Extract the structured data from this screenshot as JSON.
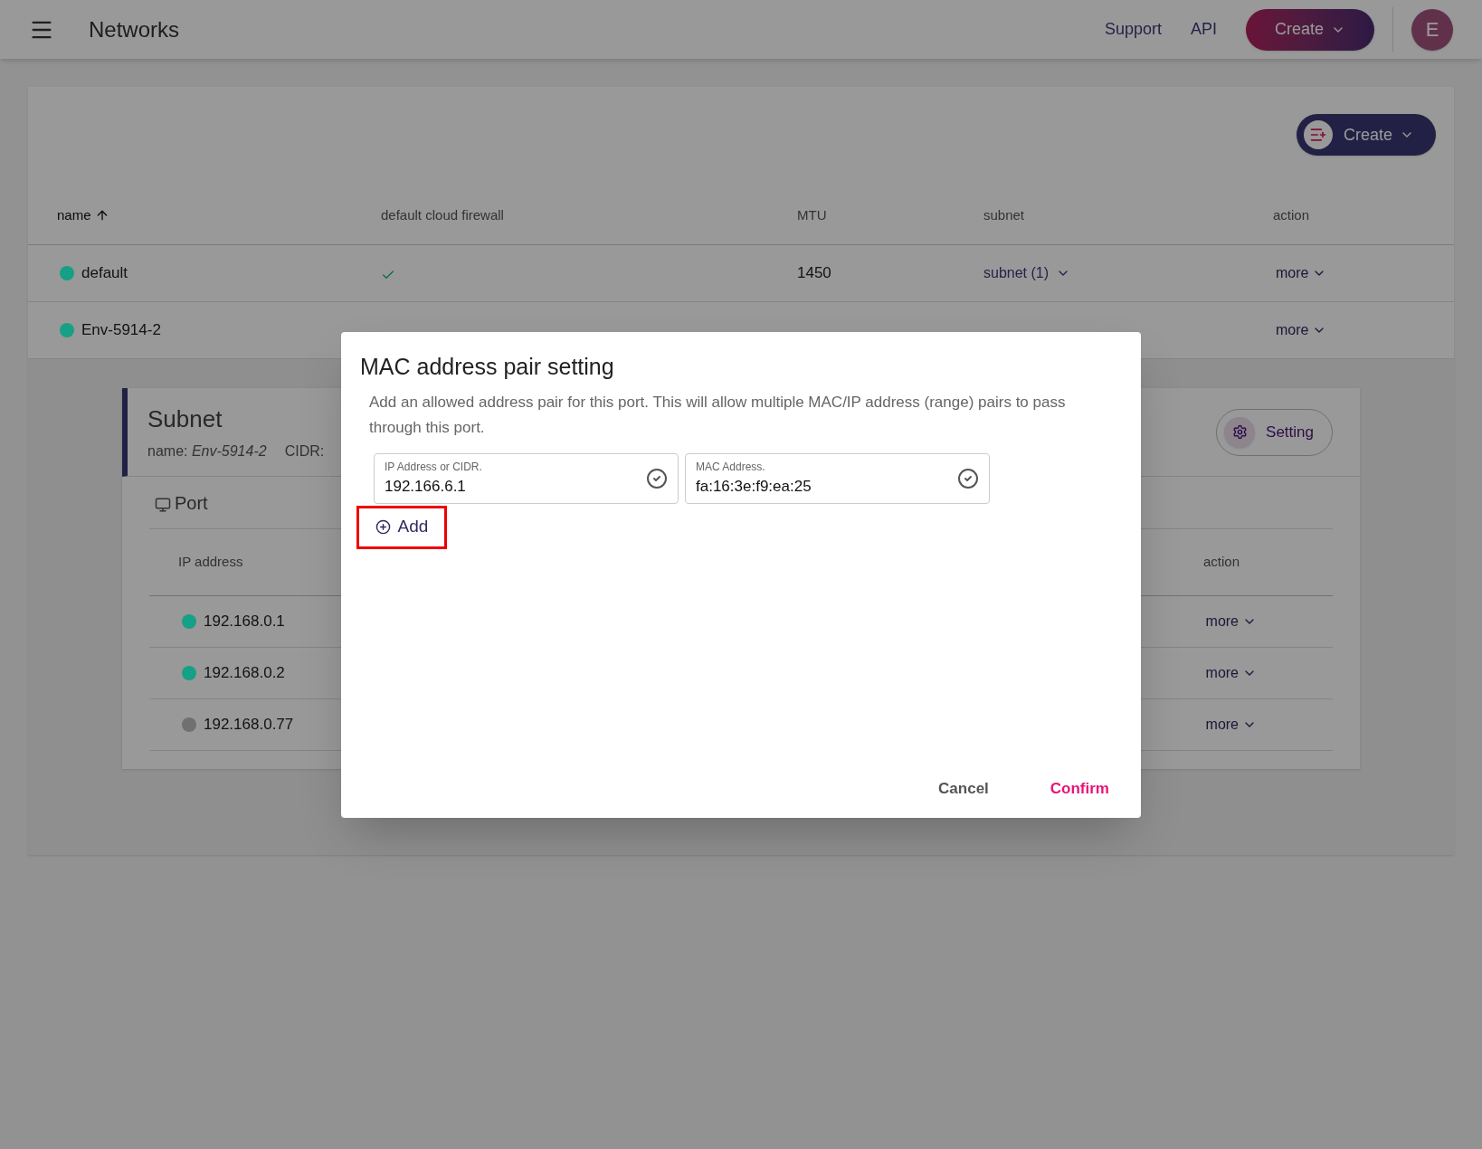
{
  "top_bar": {
    "title": "Networks",
    "links": [
      "Support",
      "API"
    ],
    "create_button": "Create",
    "avatar": "E"
  },
  "networks": {
    "create_button": "Create",
    "columns": [
      {
        "label": "name",
        "sorted": true
      },
      {
        "label": "default cloud firewall",
        "sorted": false
      },
      {
        "label": "MTU",
        "sorted": false
      },
      {
        "label": "subnet",
        "sorted": false
      },
      {
        "label": "action",
        "sorted": false
      }
    ],
    "rows": [
      {
        "name": "default",
        "color": "#16a085",
        "firewall": true,
        "mtu": "1450",
        "subnet": "subnet (1)",
        "action": "more"
      },
      {
        "name": "Env-5914-2",
        "color": "#16a085",
        "action": "more"
      }
    ]
  },
  "subnet_panel": {
    "title": "Subnet",
    "name_label": "name:",
    "name_value": "Env-5914-2",
    "cidr_label": "CIDR:",
    "setting_button": "Setting",
    "port": {
      "title": "Port",
      "columns": [
        "IP address",
        "action"
      ],
      "rows": [
        {
          "ip": "192.168.0.1",
          "color": "#16a085",
          "action": "more"
        },
        {
          "ip": "192.168.0.2",
          "color": "#16a085",
          "action": "more"
        },
        {
          "ip": "192.168.0.77",
          "color": "#707070",
          "action": "more"
        }
      ]
    }
  },
  "dialog": {
    "title": "MAC address pair setting",
    "description": "Add an allowed address pair for this port. This will allow multiple MAC/IP address (range) pairs to pass through this port.",
    "fields": [
      {
        "label": "IP Address or CIDR.",
        "value": "192.166.6.1",
        "valid": true
      },
      {
        "label": "MAC Address.",
        "value": "fa:16:3e:f9:ea:25",
        "valid": true
      }
    ],
    "add_button": "Add",
    "cancel_button": "Cancel",
    "confirm_button": "Confirm"
  }
}
